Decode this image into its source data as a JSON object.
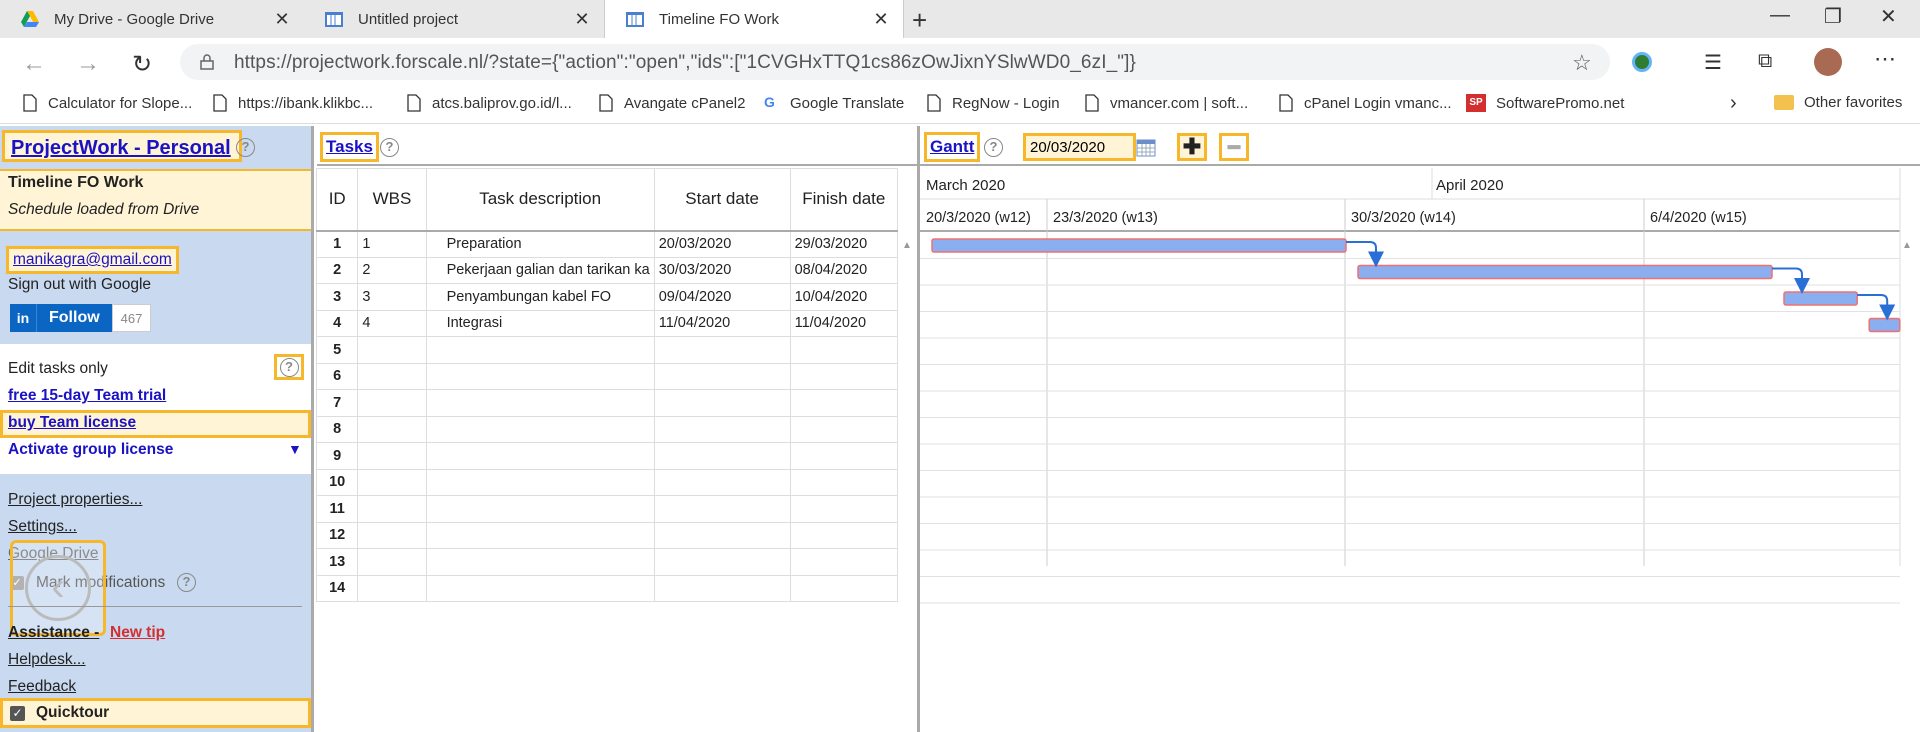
{
  "browser": {
    "tabs": [
      {
        "title": "My Drive - Google Drive",
        "active": false,
        "icon": "google-drive-icon"
      },
      {
        "title": "Untitled project",
        "active": false,
        "icon": "projectwork-icon"
      },
      {
        "title": "Timeline FO Work",
        "active": true,
        "icon": "projectwork-icon"
      }
    ],
    "url": "https://projectwork.forscale.nl/?state={\"action\":\"open\",\"ids\":[\"1CVGHxTTQ1cs86zOwJixnYSlwWD0_6zI_\"]}",
    "bookmarks": [
      "Calculator for Slope...",
      "https://ibank.klikbc...",
      "atcs.baliprov.go.id/l...",
      "Avangate cPanel2",
      "Google Translate",
      "RegNow - Login",
      "vmancer.com | soft...",
      "cPanel Login vmanc...",
      "SoftwarePromo.net"
    ],
    "other_favorites": "Other favorites"
  },
  "sidebar": {
    "title": "ProjectWork - Personal",
    "project_name": "Timeline FO Work",
    "project_status": "Schedule loaded from Drive",
    "user_email": "manikagra@gmail.com",
    "sign_out": "Sign out with Google",
    "linkedin": {
      "logo": "in",
      "follow": "Follow",
      "count": "467"
    },
    "edit_mode": "Edit tasks only",
    "team_trial": "free 15-day Team trial",
    "buy_license": "buy Team license",
    "group_license": "Activate group license",
    "group_license_arrow": "▼",
    "project_properties": "Project properties...",
    "settings": "Settings...",
    "google_drive": "Google Drive",
    "mark_modifications": "Mark modifications",
    "assistance": "Assistance - ",
    "new_tip": "New tip",
    "helpdesk": "Helpdesk...",
    "feedback": "Feedback",
    "quicktour": "Quicktour"
  },
  "tasks": {
    "header_link": "Tasks",
    "columns": [
      "ID",
      "WBS",
      "Task description",
      "Start date",
      "Finish date"
    ],
    "rows": [
      {
        "id": "1",
        "wbs": "1",
        "desc": "Preparation",
        "start": "20/03/2020",
        "finish": "29/03/2020"
      },
      {
        "id": "2",
        "wbs": "2",
        "desc": "Pekerjaan galian dan tarikan ka",
        "start": "30/03/2020",
        "finish": "08/04/2020"
      },
      {
        "id": "3",
        "wbs": "3",
        "desc": "Penyambungan kabel FO",
        "start": "09/04/2020",
        "finish": "10/04/2020"
      },
      {
        "id": "4",
        "wbs": "4",
        "desc": "Integrasi",
        "start": "11/04/2020",
        "finish": "11/04/2020"
      },
      {
        "id": "5",
        "wbs": "",
        "desc": "",
        "start": "",
        "finish": ""
      },
      {
        "id": "6",
        "wbs": "",
        "desc": "",
        "start": "",
        "finish": ""
      },
      {
        "id": "7",
        "wbs": "",
        "desc": "",
        "start": "",
        "finish": ""
      },
      {
        "id": "8",
        "wbs": "",
        "desc": "",
        "start": "",
        "finish": ""
      },
      {
        "id": "9",
        "wbs": "",
        "desc": "",
        "start": "",
        "finish": ""
      },
      {
        "id": "10",
        "wbs": "",
        "desc": "",
        "start": "",
        "finish": ""
      },
      {
        "id": "11",
        "wbs": "",
        "desc": "",
        "start": "",
        "finish": ""
      },
      {
        "id": "12",
        "wbs": "",
        "desc": "",
        "start": "",
        "finish": ""
      },
      {
        "id": "13",
        "wbs": "",
        "desc": "",
        "start": "",
        "finish": ""
      },
      {
        "id": "14",
        "wbs": "",
        "desc": "",
        "start": "",
        "finish": ""
      }
    ]
  },
  "gantt": {
    "header_link": "Gantt",
    "start_date": "20/03/2020",
    "months": [
      "March 2020",
      "April 2020"
    ],
    "weeks": [
      "20/3/2020 (w12)",
      "23/3/2020 (w13)",
      "30/3/2020 (w14)",
      "6/4/2020 (w15)"
    ],
    "bar_color": "#8aaef0",
    "bar_border": "#f07070",
    "link_color": "#2a6fd6"
  }
}
